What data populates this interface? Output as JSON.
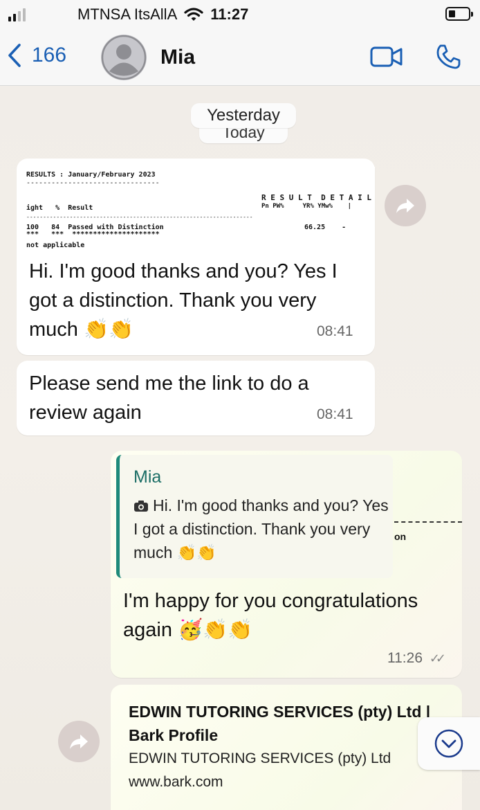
{
  "status_bar": {
    "carrier": "MTNSA ItsAllA",
    "time": "11:27"
  },
  "header": {
    "back_count": "166",
    "contact_name": "Mia"
  },
  "date_dividers": [
    "Yesterday",
    "Today"
  ],
  "results_image": {
    "lines": [
      "RESULTS : January/February 2023",
      "--------------------------------",
      "R E S U L T  D E T A I L",
      "ight   %  Result",
      "Pn PW%     YR% YMw%    |",
      "--------------------------------------------------------------------",
      "100   84  Passed with Distinction",
      "66.25    -",
      "***   ***  *********************",
      "not applicable"
    ]
  },
  "messages": [
    {
      "direction": "in",
      "text": "Hi. I'm good thanks and you? Yes I got a distinction. Thank you very much 👏👏",
      "time": "08:41"
    },
    {
      "direction": "in",
      "text": "Please send me the link to do a review again",
      "time": "08:41"
    },
    {
      "direction": "out",
      "quote_author": "Mia",
      "quote_text": "Hi. I'm good thanks and you? Yes I got a distinction. Thank you very much 👏👏",
      "quote_fragment": "on",
      "text": "I'm happy for you congratulations again 🥳👏👏",
      "time": "11:26",
      "ticks": "✓✓"
    },
    {
      "direction": "out",
      "link_title": "EDWIN TUTORING SERVICES (pty) Ltd | Bark Profile",
      "link_desc": "EDWIN TUTORING SERVICES (pty) Ltd",
      "link_url": "www.bark.com"
    }
  ],
  "icons": {
    "back": "chevron-left-icon",
    "avatar": "person-icon",
    "video": "video-camera-icon",
    "phone": "phone-icon",
    "forward": "forward-arrow-icon",
    "scroll": "chevron-down-icon"
  },
  "colors": {
    "accent_blue": "#1a5fb4",
    "quote_bar": "#1e8a7a",
    "quote_name": "#1c6e66"
  }
}
